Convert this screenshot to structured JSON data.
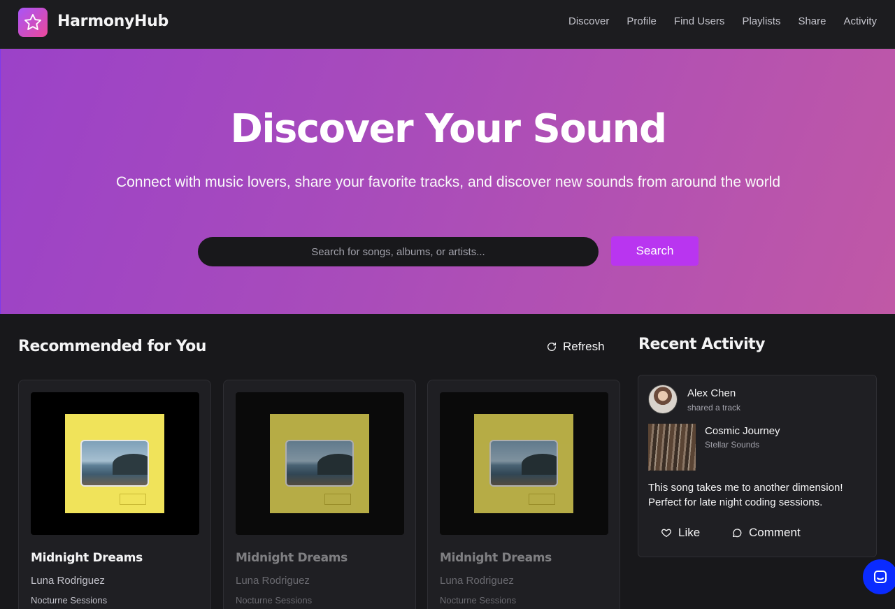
{
  "nav": {
    "brand": "HarmonyHub",
    "logo_icon": "star-icon",
    "links": [
      "Discover",
      "Profile",
      "Find Users",
      "Playlists",
      "Share",
      "Activity"
    ]
  },
  "hero": {
    "title": "Discover Your Sound",
    "subtitle": "Connect with music lovers, share your favorite tracks, and discover new sounds from around the world",
    "search_placeholder": "Search for songs, albums, or artists...",
    "search_button": "Search"
  },
  "recommended": {
    "title": "Recommended for You",
    "refresh_label": "Refresh",
    "cards": [
      {
        "title": "Midnight Dreams",
        "artist": "Luna Rodriguez",
        "album": "Nocturne Sessions"
      },
      {
        "title": "Midnight Dreams",
        "artist": "Luna Rodriguez",
        "album": "Nocturne Sessions"
      },
      {
        "title": "Midnight Dreams",
        "artist": "Luna Rodriguez",
        "album": "Nocturne Sessions"
      }
    ]
  },
  "activity": {
    "title": "Recent Activity",
    "items": [
      {
        "user": "Alex Chen",
        "action": "shared a track",
        "track": "Cosmic Journey",
        "artist": "Stellar Sounds",
        "comment": "This song takes me to another dimension! Perfect for late night coding sessions.",
        "like_label": "Like",
        "comment_label": "Comment"
      }
    ]
  },
  "colors": {
    "accent": "#b935f0",
    "hero_gradient_start": "#9b42c8",
    "hero_gradient_end": "#c058a6",
    "background": "#18181b",
    "chat_button": "#0a2bff"
  }
}
